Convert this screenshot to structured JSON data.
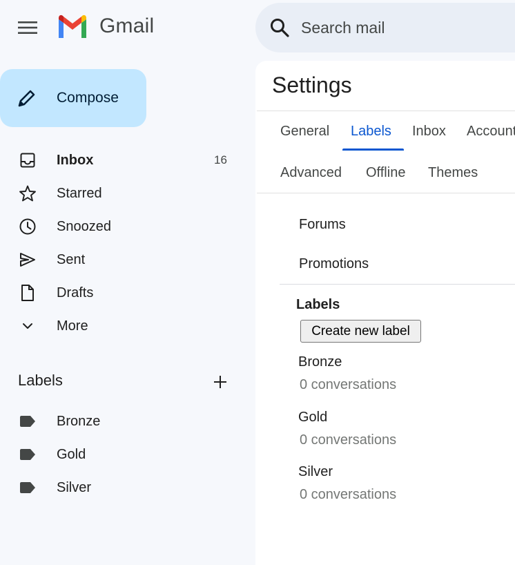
{
  "header": {
    "app_name": "Gmail",
    "search_placeholder": "Search mail"
  },
  "compose": {
    "label": "Compose"
  },
  "sidebar": {
    "items": [
      {
        "label": "Inbox",
        "count": "16",
        "icon": "inbox-icon"
      },
      {
        "label": "Starred",
        "icon": "star-icon"
      },
      {
        "label": "Snoozed",
        "icon": "clock-icon"
      },
      {
        "label": "Sent",
        "icon": "send-icon"
      },
      {
        "label": "Drafts",
        "icon": "draft-icon"
      },
      {
        "label": "More",
        "icon": "chevron-down-icon"
      }
    ],
    "labels_heading": "Labels",
    "labels": [
      "Bronze",
      "Gold",
      "Silver"
    ]
  },
  "settings": {
    "title": "Settings",
    "tabs_row1": [
      "General",
      "Labels",
      "Inbox",
      "Accounts"
    ],
    "tabs_row2": [
      "Advanced",
      "Offline",
      "Themes"
    ],
    "active_tab": "Labels",
    "categories": [
      "Forums",
      "Promotions"
    ],
    "labels_section_title": "Labels",
    "create_label_button": "Create new label",
    "user_labels": [
      {
        "name": "Bronze",
        "count": "0 conversations"
      },
      {
        "name": "Gold",
        "count": "0 conversations"
      },
      {
        "name": "Silver",
        "count": "0 conversations"
      }
    ]
  },
  "colors": {
    "background": "#f6f8fc",
    "compose_bg": "#c2e7ff",
    "search_bg": "#e9eef6",
    "accent": "#0b57d0"
  }
}
